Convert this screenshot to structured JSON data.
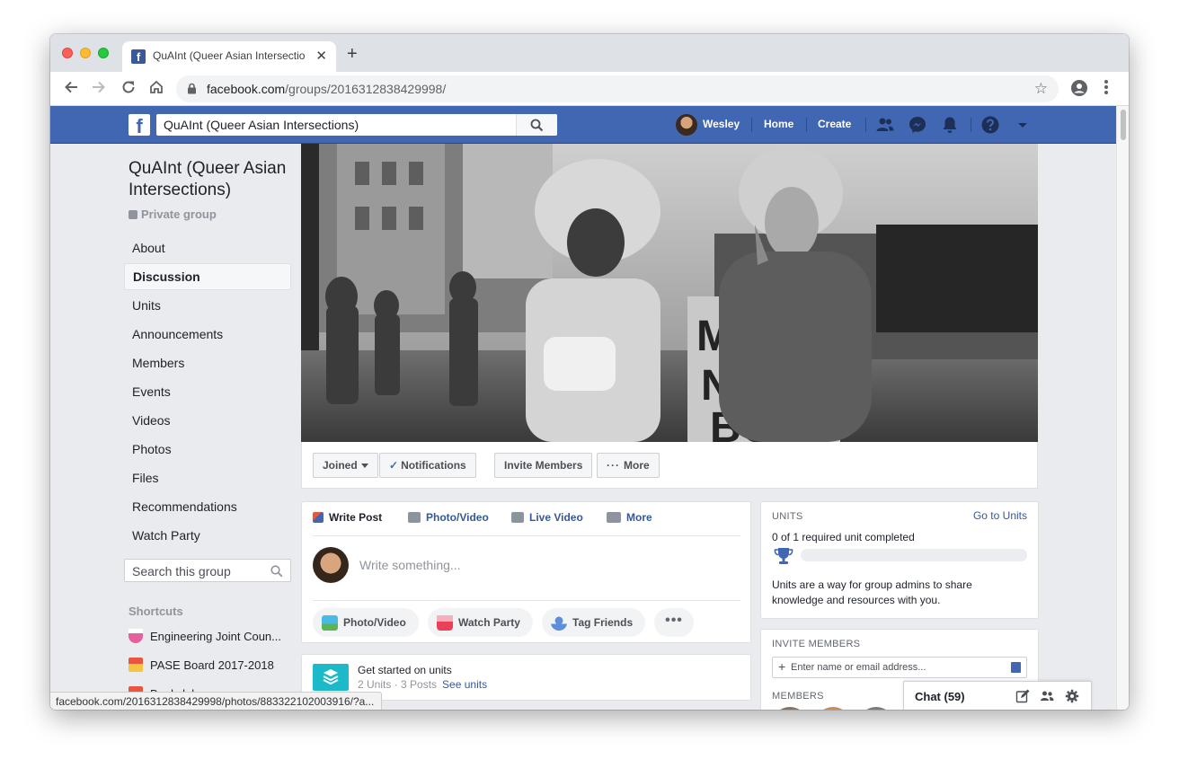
{
  "browser": {
    "tab_title": "QuAInt (Queer Asian Intersectio",
    "tab_close": "✕",
    "new_tab": "+",
    "url_host": "facebook.com",
    "url_path": "/groups/2016312838429998/",
    "status_url": "facebook.com/2016312838429998/photos/883322102003916/?a..."
  },
  "fb_header": {
    "search_value": "QuAInt (Queer Asian Intersections)",
    "user_name": "Wesley",
    "home_label": "Home",
    "create_label": "Create"
  },
  "sidebar": {
    "group_name": "QuAInt (Queer Asian Intersections)",
    "privacy": "Private group",
    "nav": [
      "About",
      "Discussion",
      "Units",
      "Announcements",
      "Members",
      "Events",
      "Videos",
      "Photos",
      "Files",
      "Recommendations",
      "Watch Party"
    ],
    "active_nav": "Discussion",
    "search_placeholder": "Search this group",
    "shortcuts_title": "Shortcuts",
    "shortcuts": [
      "Engineering Joint Coun...",
      "PASE Board 2017-2018",
      "Bookclub"
    ]
  },
  "actions": {
    "joined": "Joined",
    "notifications": "Notifications",
    "invite": "Invite Members",
    "more": "More"
  },
  "composer": {
    "tabs": [
      "Write Post",
      "Photo/Video",
      "Live Video",
      "More"
    ],
    "placeholder": "Write something...",
    "pills": [
      "Photo/Video",
      "Watch Party",
      "Tag Friends"
    ],
    "more_dots": "•••"
  },
  "units_start": {
    "title": "Get started on units",
    "meta": "2 Units · 3 Posts",
    "link": "See units"
  },
  "units_card": {
    "label": "UNITS",
    "link": "Go to Units",
    "progress_text": "0 of 1 required unit completed",
    "progress_fraction": 0,
    "description": "Units are a way for group admins to share knowledge and resources with you."
  },
  "invite_card": {
    "label": "INVITE MEMBERS",
    "placeholder": "Enter name or email address...",
    "members_label": "MEMBERS"
  },
  "chat": {
    "label": "Chat (59)"
  },
  "colors": {
    "fb_blue": "#4267b2",
    "link": "#365899",
    "page_bg": "#e9ebee"
  }
}
